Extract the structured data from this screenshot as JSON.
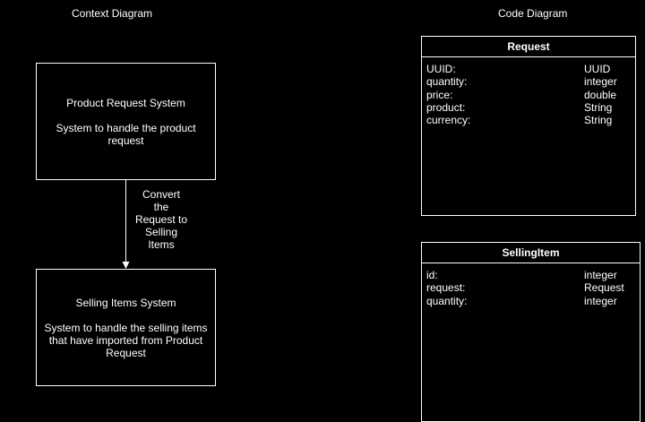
{
  "context_diagram": {
    "title": "Context Diagram",
    "product_request_system": {
      "title": "Product Request System",
      "description": "System to handle the product request"
    },
    "arrow_label": "Convert the Request to Selling Items",
    "selling_items_system": {
      "title": "Selling Items System",
      "description": "System to handle the selling items that have imported from Product Request"
    }
  },
  "code_diagram": {
    "title": "Code Diagram",
    "request_class": {
      "name": "Request",
      "attributes": [
        {
          "name": "UUID:",
          "type": "UUID"
        },
        {
          "name": "quantity:",
          "type": "integer"
        },
        {
          "name": "price:",
          "type": "double"
        },
        {
          "name": "product:",
          "type": "String"
        },
        {
          "name": "currency:",
          "type": "String"
        }
      ]
    },
    "selling_item_class": {
      "name": "SellingItem",
      "attributes": [
        {
          "name": "id:",
          "type": "integer"
        },
        {
          "name": "request:",
          "type": "Request"
        },
        {
          "name": "quantity:",
          "type": "integer"
        }
      ]
    }
  },
  "colors": {
    "background": "#000000",
    "stroke": "#ffffff",
    "text": "#ffffff"
  }
}
